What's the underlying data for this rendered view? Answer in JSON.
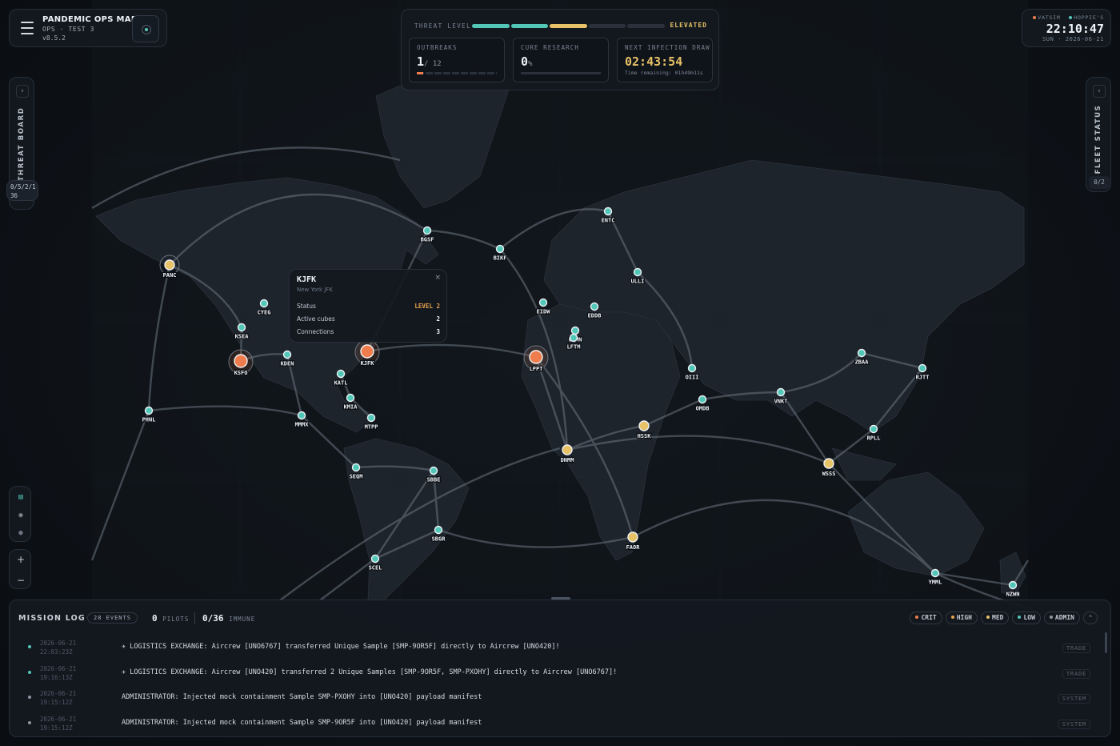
{
  "app": {
    "title": "PANDEMIC OPS MAP",
    "subtitle": "OPS · TEST 3",
    "version": "v8.5.2"
  },
  "threat": {
    "label": "THREAT LEVEL",
    "value": "ELEVATED",
    "level_segments": 8,
    "level_filled": 4
  },
  "stats": {
    "outbreaks": {
      "label": "OUTBREAKS",
      "value": "1",
      "total": "/ 12",
      "fraction": 0.083
    },
    "cure": {
      "label": "CURE RESEARCH",
      "value": "0",
      "unit": "%",
      "fraction": 0
    },
    "draw": {
      "label": "NEXT INFECTION DRAW",
      "value": "02:43:54",
      "remaining": "Time remaining: 01h49m11s"
    }
  },
  "clock": {
    "net1": "VATSIM",
    "net2": "HOPPIE'S",
    "time": "22:10:47",
    "date": "SUN · 2026-06-21",
    "net1_color": "#ef7c4c",
    "net2_color": "#52c7b8"
  },
  "threat_board": {
    "label": "THREAT BOARD",
    "counts": "0/5/2/1",
    "total": "36"
  },
  "fleet_status": {
    "label": "FLEET STATUS",
    "count": "0/2"
  },
  "zoom": {
    "in": "+",
    "out": "−"
  },
  "popup": {
    "title": "KJFK",
    "subtitle": "New York JFK",
    "close": "×",
    "rows": [
      {
        "label": "Status",
        "value": "LEVEL 2"
      },
      {
        "label": "Active cubes",
        "value": "2"
      },
      {
        "label": "Connections",
        "value": "3"
      }
    ]
  },
  "airports": [
    {
      "code": "PANC",
      "type": "yellow"
    },
    {
      "code": "CYEG",
      "type": "teal"
    },
    {
      "code": "KSEA",
      "type": "teal"
    },
    {
      "code": "KSFO",
      "type": "orange"
    },
    {
      "code": "KDEN",
      "type": "teal"
    },
    {
      "code": "KJFK",
      "type": "orange"
    },
    {
      "code": "KATL",
      "type": "teal"
    },
    {
      "code": "KMIA",
      "type": "teal"
    },
    {
      "code": "MTPP",
      "type": "teal"
    },
    {
      "code": "MMMX",
      "type": "teal"
    },
    {
      "code": "PHNL",
      "type": "teal"
    },
    {
      "code": "SEQM",
      "type": "teal"
    },
    {
      "code": "SBBE",
      "type": "teal"
    },
    {
      "code": "SBGR",
      "type": "teal"
    },
    {
      "code": "SCEL",
      "type": "teal"
    },
    {
      "code": "BGSF",
      "type": "teal"
    },
    {
      "code": "BIKF",
      "type": "teal"
    },
    {
      "code": "ENTC",
      "type": "teal"
    },
    {
      "code": "ULLI",
      "type": "teal"
    },
    {
      "code": "EIDW",
      "type": "teal"
    },
    {
      "code": "EDDB",
      "type": "teal"
    },
    {
      "code": "LFMN",
      "type": "teal"
    },
    {
      "code": "LFTM",
      "type": "teal"
    },
    {
      "code": "LPPT",
      "type": "orange"
    },
    {
      "code": "DNMM",
      "type": "yellow"
    },
    {
      "code": "FAOR",
      "type": "yellow"
    },
    {
      "code": "HSSK",
      "type": "yellow"
    },
    {
      "code": "OIII",
      "type": "teal"
    },
    {
      "code": "OMDB",
      "type": "teal"
    },
    {
      "code": "VNKT",
      "type": "teal"
    },
    {
      "code": "ZBAA",
      "type": "teal"
    },
    {
      "code": "RJTT",
      "type": "teal"
    },
    {
      "code": "RPLL",
      "type": "teal"
    },
    {
      "code": "WSSS",
      "type": "yellow"
    },
    {
      "code": "YMML",
      "type": "teal"
    },
    {
      "code": "NZWN",
      "type": "teal"
    }
  ],
  "mission_log": {
    "title": "MISSION LOG",
    "events": "28 EVENTS",
    "pilots": "0",
    "pilots_label": "PILOTS",
    "immune": "0/36",
    "immune_label": "IMMUNE",
    "filters": [
      {
        "label": "CRIT",
        "color": "#ef7c4c"
      },
      {
        "label": "HIGH",
        "color": "#e7a44b"
      },
      {
        "label": "MED",
        "color": "#e7c266"
      },
      {
        "label": "LOW",
        "color": "#52c7b8"
      },
      {
        "label": "ADMIN",
        "color": "#8d97a3"
      }
    ],
    "collapse": "⌃",
    "entries": [
      {
        "date": "2026-06-21",
        "time": "22:03:23Z",
        "message": "✈ LOGISTICS EXCHANGE: Aircrew [UNO6767] transferred Unique Sample [SMP-9OR5F] directly to Aircrew [UNO420]!",
        "tag": "TRADE",
        "color": "#52c7b8"
      },
      {
        "date": "2026-06-21",
        "time": "19:16:13Z",
        "message": "✈ LOGISTICS EXCHANGE: Aircrew [UNO420] transferred 2 Unique Samples [SMP-9OR5F, SMP-PXOHY] directly to Aircrew [UNO6767]!",
        "tag": "TRADE",
        "color": "#52c7b8"
      },
      {
        "date": "2026-06-21",
        "time": "19:15:12Z",
        "message": "ADMINISTRATOR: Injected mock containment Sample SMP-PXOHY into [UNO420] payload manifest",
        "tag": "SYSTEM",
        "color": "#8d97a3"
      },
      {
        "date": "2026-06-21",
        "time": "19:15:12Z",
        "message": "ADMINISTRATOR: Injected mock containment Sample SMP-9OR5F into [UNO420] payload manifest",
        "tag": "SYSTEM",
        "color": "#8d97a3"
      }
    ]
  }
}
